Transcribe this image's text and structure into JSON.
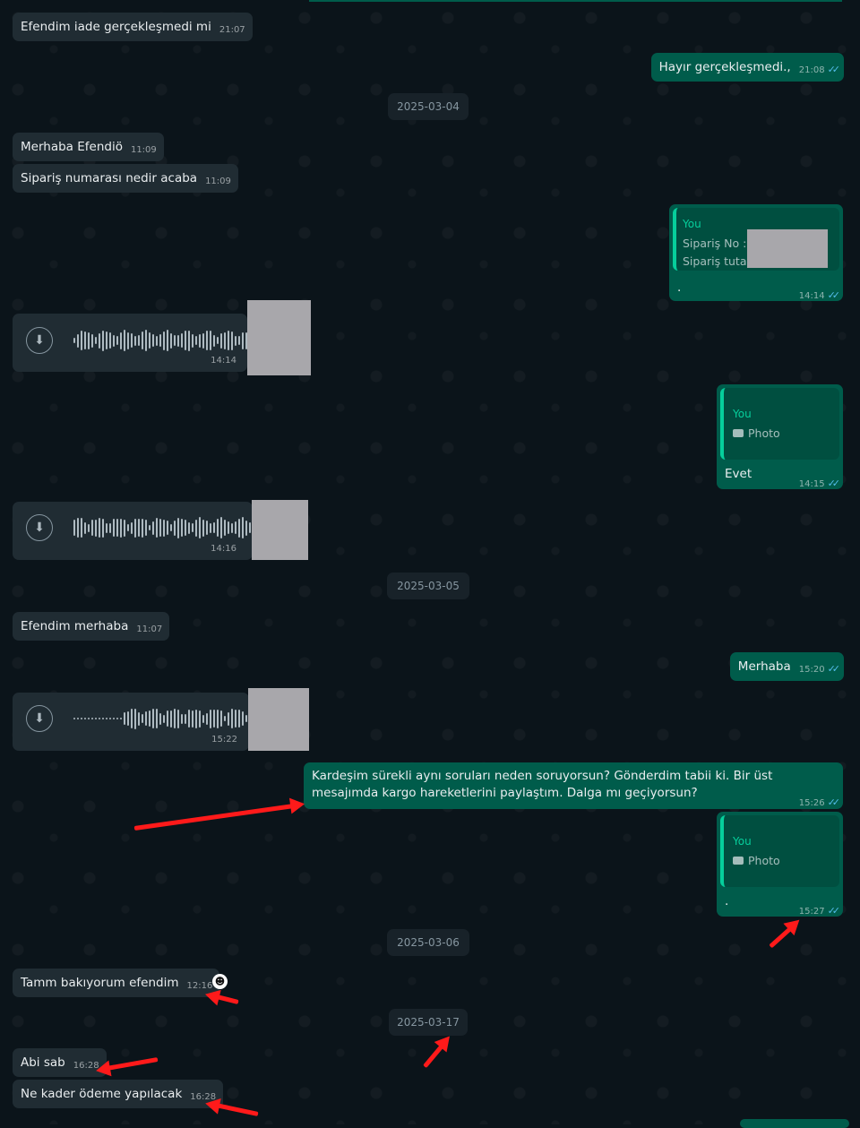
{
  "messages": {
    "m1": {
      "text": "Efendim iade gerçekleşmedi mi",
      "time": "21:07"
    },
    "m2": {
      "text": "Hayır gerçekleşmedi.,",
      "time": "21:08"
    },
    "d1": "2025-03-04",
    "m3": {
      "text": "Merhaba Efendiö",
      "time": "11:09"
    },
    "m4": {
      "text": "Sipariş numarası nedir acaba",
      "time": "11:09"
    },
    "m5": {
      "quote_author": "You",
      "quote_line1": "Sipariş No :",
      "quote_line2": "Sipariş tutar",
      "text": ".",
      "time": "14:14"
    },
    "a1": {
      "time": "14:14"
    },
    "m6": {
      "quote_author": "You",
      "quote_media": "Photo",
      "text": "Evet",
      "time": "14:15"
    },
    "a2": {
      "time": "14:16"
    },
    "d2": "2025-03-05",
    "m7": {
      "text": "Efendim merhaba",
      "time": "11:07"
    },
    "m8": {
      "text": "Merhaba",
      "time": "15:20"
    },
    "a3": {
      "time": "15:22"
    },
    "m9": {
      "text": "Kardeşim sürekli aynı soruları neden soruyorsun? Gönderdim tabii ki. Bir üst mesajımda kargo hareketlerini paylaştım. Dalga mı geçiyorsun?",
      "time": "15:26"
    },
    "m10": {
      "quote_author": "You",
      "quote_media": "Photo",
      "text": ".",
      "time": "15:27"
    },
    "d3": "2025-03-06",
    "m11": {
      "text": "Tamm bakıyorum efendim",
      "time": "12:16"
    },
    "d4": "2025-03-17",
    "m12": {
      "text": "Abi sab",
      "time": "16:28"
    },
    "m13": {
      "text": "Ne kader ödeme yapılacak",
      "time": "16:28"
    }
  },
  "icons": {
    "read_receipt": "double-check-icon",
    "download": "download-icon",
    "camera": "camera-icon",
    "reaction": "smiley-emoji-icon"
  },
  "colors": {
    "incoming": "#202c33",
    "outgoing": "#005c4b",
    "background": "#0b141a",
    "accent": "#06cf9c",
    "annotation_arrow": "#ff1a1a"
  }
}
